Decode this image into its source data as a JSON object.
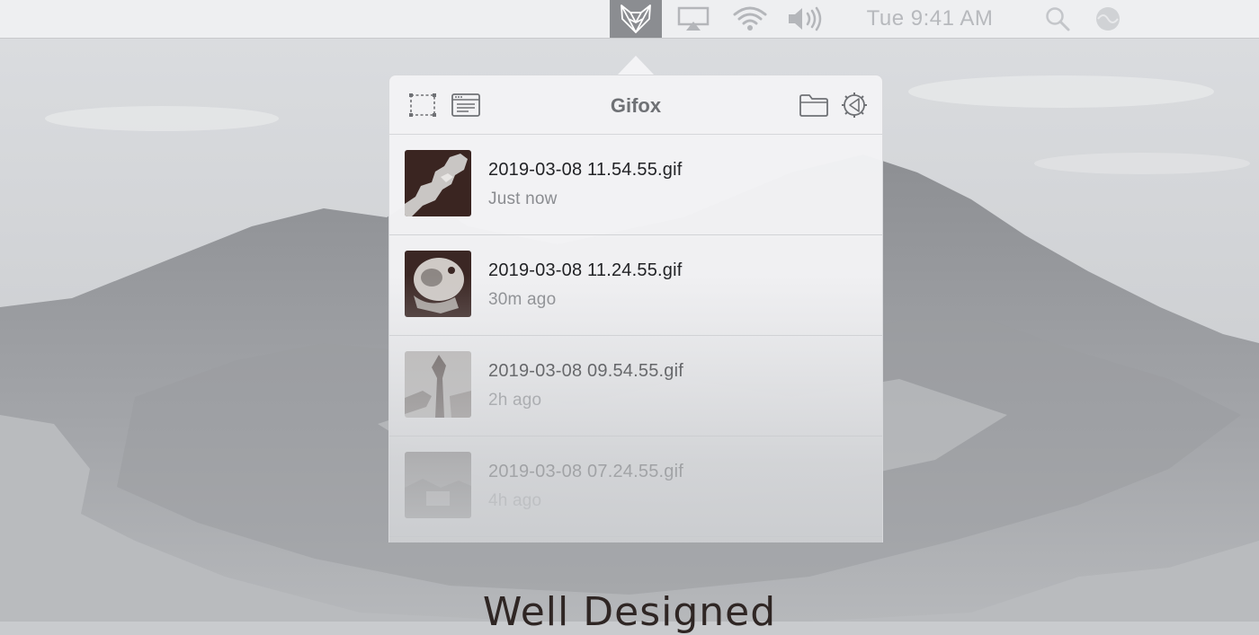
{
  "menubar": {
    "icons": [
      "gifox-fox-icon",
      "airplay-icon",
      "wifi-icon",
      "volume-icon",
      "spotlight-search-icon",
      "siri-icon"
    ],
    "clock": "Tue 9:41 AM"
  },
  "popover": {
    "title": "Gifox",
    "toolbar_icons": [
      "area-capture-icon",
      "window-capture-icon",
      "folder-icon",
      "settings-icon"
    ],
    "recordings": [
      {
        "filename": "2019-03-08 11.54.55.gif",
        "time": "Just now"
      },
      {
        "filename": "2019-03-08 11.24.55.gif",
        "time": "30m ago"
      },
      {
        "filename": "2019-03-08 09.54.55.gif",
        "time": "2h ago"
      },
      {
        "filename": "2019-03-08 07.24.55.gif",
        "time": "4h ago"
      }
    ]
  },
  "headline": "Well Designed",
  "colors": {
    "menubar_bg": "#eeeff1",
    "gifox_highlight": "#8b8d91",
    "popover_bg": "#f3f3f5",
    "title_text": "#6f7175",
    "secondary_text": "#8a8c90"
  }
}
